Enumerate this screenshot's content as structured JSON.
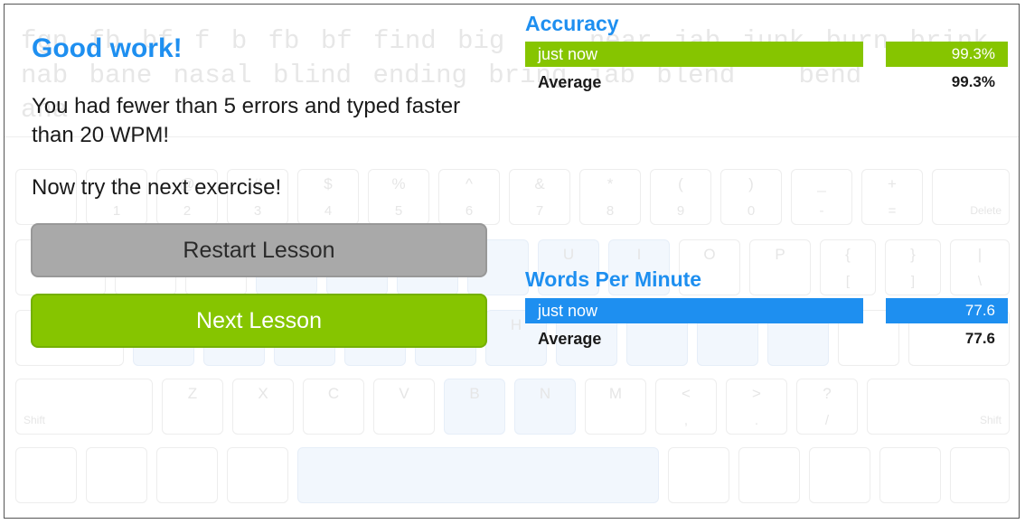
{
  "colors": {
    "accent_blue": "#1e8ff0",
    "accuracy_green": "#86c500",
    "wpm_blue": "#1e8ff0",
    "restart_gray": "#a9a9a9"
  },
  "background": {
    "typing_text": "fgn fb bf f b fb bf find big    near jab junk burn brink nab bane nasal blind ending bring jab blend   bend            ana",
    "keyboard": {
      "row1": [
        {
          "top": "",
          "bottom": ""
        },
        {
          "top": "!",
          "bottom": "1"
        },
        {
          "top": "@",
          "bottom": "2"
        },
        {
          "top": "#",
          "bottom": "3"
        },
        {
          "top": "$",
          "bottom": "4"
        },
        {
          "top": "%",
          "bottom": "5"
        },
        {
          "top": "^",
          "bottom": "6"
        },
        {
          "top": "&",
          "bottom": "7"
        },
        {
          "top": "*",
          "bottom": "8"
        },
        {
          "top": "(",
          "bottom": "9"
        },
        {
          "top": ")",
          "bottom": "0"
        },
        {
          "top": "_",
          "bottom": "-"
        },
        {
          "top": "+",
          "bottom": "="
        }
      ],
      "delete_label": "Delete",
      "row2_letters": [
        "U",
        "I",
        "O",
        "P"
      ],
      "row2_brackets": [
        {
          "top": "{",
          "bottom": "["
        },
        {
          "top": "}",
          "bottom": "]"
        },
        {
          "top": "|",
          "bottom": "\\"
        }
      ],
      "row3_letter": "H",
      "row4_letters": [
        "Z",
        "X",
        "C",
        "V",
        "B",
        "N",
        "M"
      ],
      "row4_punct": [
        {
          "top": "<",
          "bottom": ","
        },
        {
          "top": ">",
          "bottom": "."
        },
        {
          "top": "?",
          "bottom": "/"
        }
      ],
      "shift_label": "Shift"
    }
  },
  "result": {
    "title": "Good work!",
    "message": "You had fewer than 5 errors and typed faster than 20 WPM!",
    "next_prompt": "Now try the next exercise!",
    "restart_label": "Restart Lesson",
    "next_label": "Next Lesson"
  },
  "stats": {
    "accuracy": {
      "title": "Accuracy",
      "now_label": "just now",
      "now_value": "99.3%",
      "avg_label": "Average",
      "avg_value": "99.3%"
    },
    "wpm": {
      "title": "Words Per Minute",
      "now_label": "just now",
      "now_value": "77.6",
      "avg_label": "Average",
      "avg_value": "77.6"
    }
  }
}
